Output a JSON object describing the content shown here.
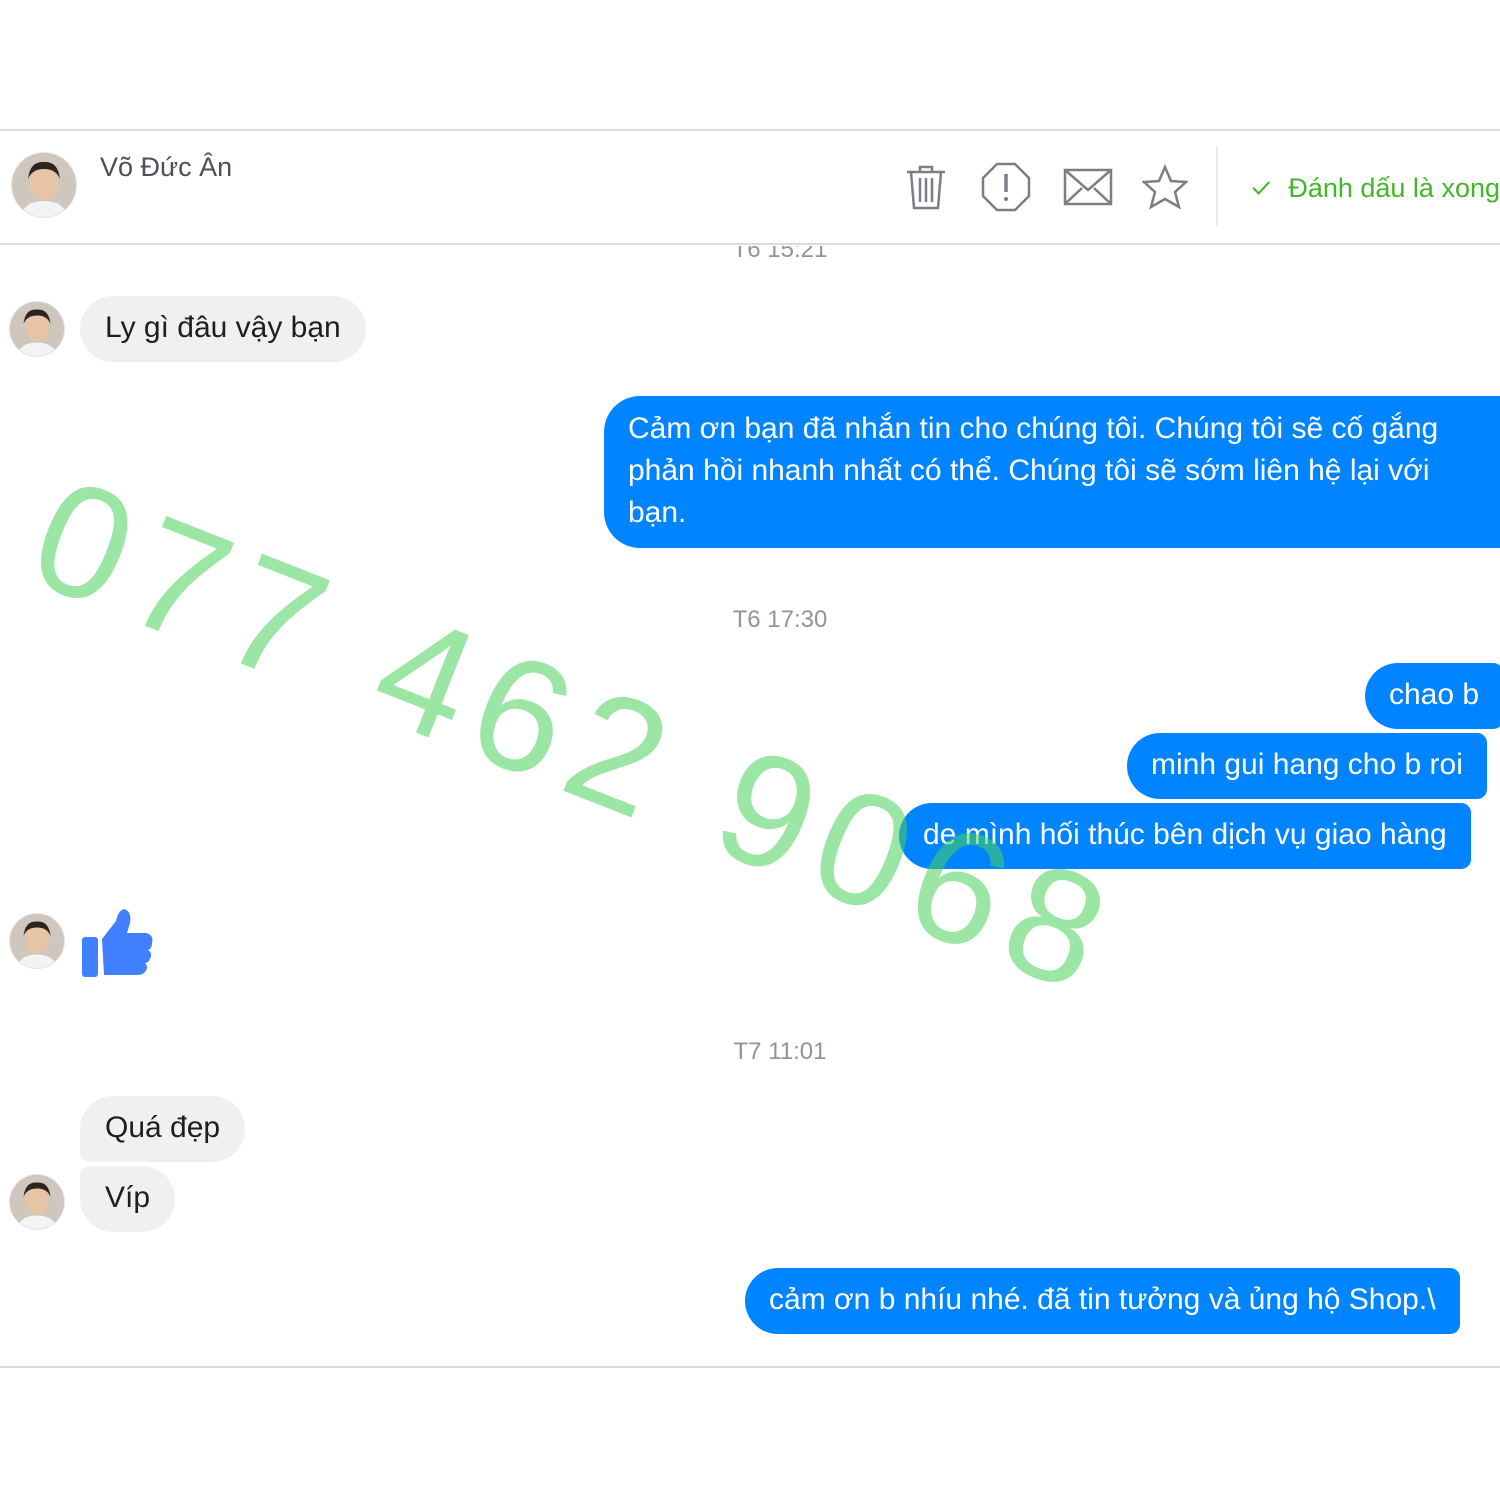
{
  "header": {
    "contact_name": "Võ Đức Ân",
    "actions": [
      {
        "name": "delete",
        "icon": "trash-icon"
      },
      {
        "name": "report",
        "icon": "alert-octagon-icon"
      },
      {
        "name": "mark-unread",
        "icon": "envelope-icon"
      },
      {
        "name": "star",
        "icon": "star-icon"
      }
    ],
    "mark_done_label": "Đánh dấu là xong",
    "mark_done_icon": "checkmark-icon",
    "accent_color": "#42b72a"
  },
  "conversation": {
    "timestamps": [
      "T6 15:21",
      "T6 17:30",
      "T7 11:01"
    ],
    "messages": [
      {
        "from": "contact",
        "text": "Ly gì đâu vậy bạn"
      },
      {
        "from": "page",
        "text": "Cảm ơn bạn đã nhắn tin cho chúng tôi. Chúng tôi sẽ cố gắng phản hồi nhanh nhất có thể. Chúng tôi sẽ sớm liên hệ lại với bạn."
      },
      {
        "from": "page",
        "text": "chao b"
      },
      {
        "from": "page",
        "text": "minh gui hang cho b roi"
      },
      {
        "from": "page",
        "text": "de mình hối thúc bên dịch vụ giao hàng"
      },
      {
        "from": "contact",
        "icon": "thumbs-up-icon"
      },
      {
        "from": "contact",
        "text": "Quá đẹp"
      },
      {
        "from": "contact",
        "text": "Víp"
      },
      {
        "from": "page",
        "text": "cảm ơn b nhíu nhé. đã tin tưởng và ủng hộ Shop.\\"
      }
    ],
    "outgoing_color": "#0084ff",
    "incoming_color": "#f1f0f0",
    "like_color": "#4080ff"
  },
  "watermark": {
    "text": "077 462 9068",
    "color": "#48d25a"
  }
}
